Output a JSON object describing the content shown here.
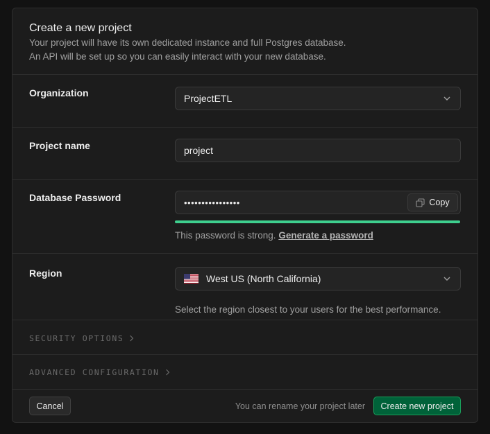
{
  "header": {
    "title": "Create a new project",
    "subtitle_line1": "Your project will have its own dedicated instance and full Postgres database.",
    "subtitle_line2": "An API will be set up so you can easily interact with your new database."
  },
  "organization": {
    "label": "Organization",
    "value": "ProjectETL",
    "icon": "chevron-down-icon"
  },
  "project_name": {
    "label": "Project name",
    "value": "project"
  },
  "password": {
    "label": "Database Password",
    "value": "••••••••••••••••",
    "copy_label": "Copy",
    "strength_text": "This password is strong.",
    "generate_link": "Generate a password",
    "strength_fraction": 1.0
  },
  "region": {
    "label": "Region",
    "value": "West US (North California)",
    "flag": "us-flag-icon",
    "hint": "Select the region closest to your users for the best performance."
  },
  "security": {
    "label": "SECURITY OPTIONS",
    "icon": "chevron-right-icon"
  },
  "advanced": {
    "label": "ADVANCED CONFIGURATION",
    "icon": "chevron-right-icon"
  },
  "footer": {
    "cancel_label": "Cancel",
    "note": "You can rename your project later",
    "create_label": "Create new project"
  },
  "colors": {
    "accent": "#3ecf8e",
    "primary_button": "#006239",
    "background": "#1c1c1c"
  }
}
